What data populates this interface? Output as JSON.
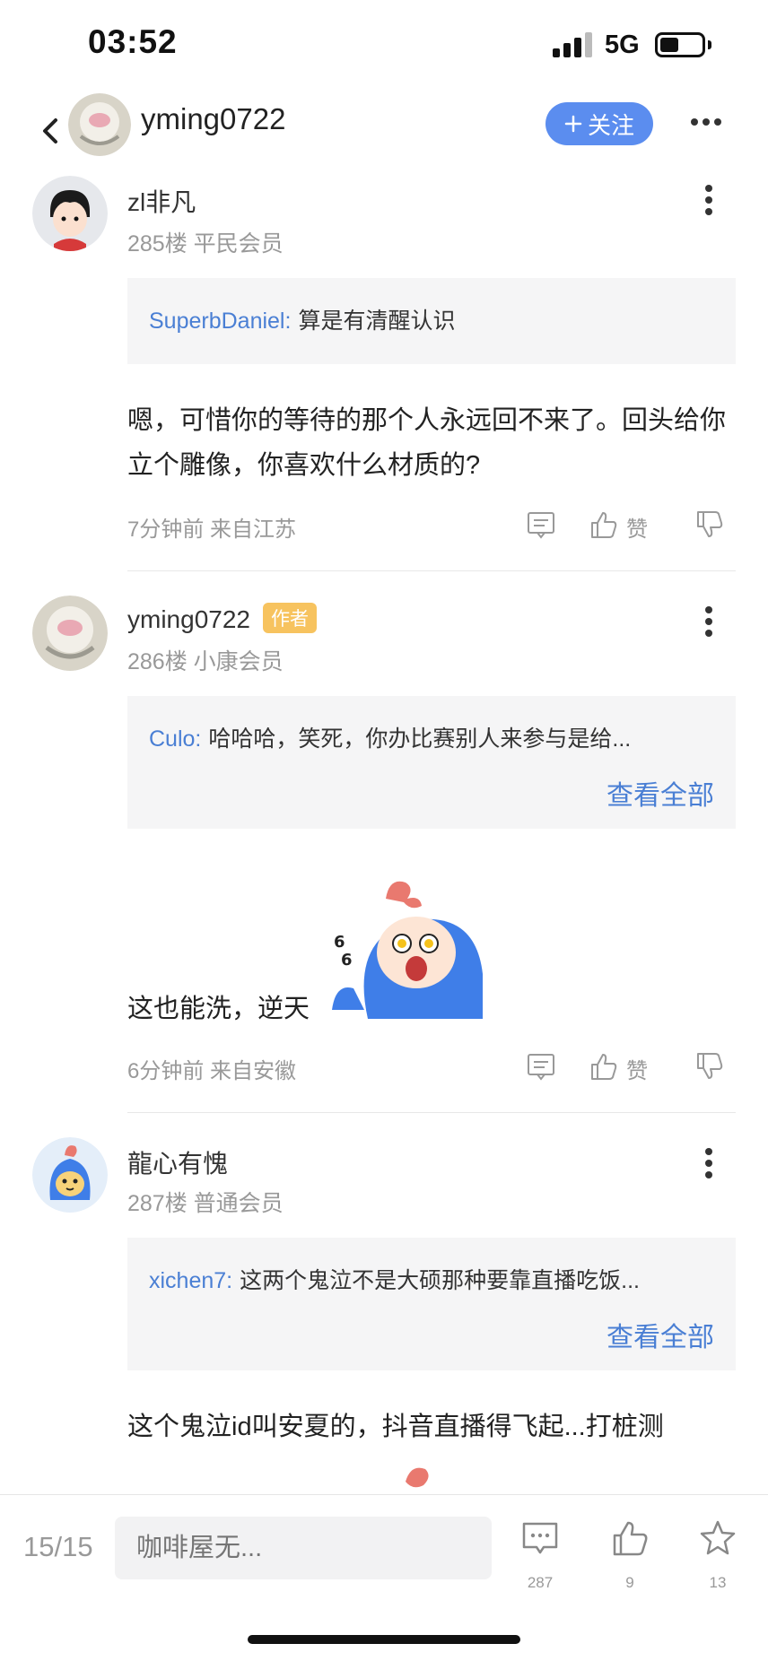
{
  "status_bar": {
    "time": "03:52",
    "network": "5G"
  },
  "nav": {
    "username": "yming0722",
    "follow_label": "关注"
  },
  "posts": [
    {
      "username": "zl非凡",
      "meta": "285楼 平民会员",
      "quote_user": "SuperbDaniel:",
      "quote_text": "算是有清醒认识",
      "body": "嗯，可惜你的等待的那个人永远回不来了。回头给你立个雕像，你喜欢什么材质的?",
      "time_loc": "7分钟前 来自江苏",
      "like_label": "赞"
    },
    {
      "username": "yming0722",
      "badge": "作者",
      "meta": "286楼 小康会员",
      "quote_user": "Culo:",
      "quote_text": "哈哈哈，笑死，你办比赛别人来参与是给...",
      "see_all": "查看全部",
      "body": "这也能洗，逆天",
      "time_loc": "6分钟前 来自安徽",
      "like_label": "赞"
    },
    {
      "username": "龍心有愧",
      "meta": "287楼 普通会员",
      "quote_user": "xichen7:",
      "quote_text": "这两个鬼泣不是大硕那种要靠直播吃饭...",
      "see_all": "查看全部",
      "body": "这个鬼泣id叫安夏的，抖音直播得飞起...打桩测"
    }
  ],
  "bottom_bar": {
    "page": "15/15",
    "reply_placeholder": "咖啡屋无...",
    "comment_count": "287",
    "like_count": "9",
    "fav_count": "13"
  },
  "colors": {
    "accent": "#5b8def",
    "link": "#4a7fd4",
    "badge": "#f7c35f"
  }
}
